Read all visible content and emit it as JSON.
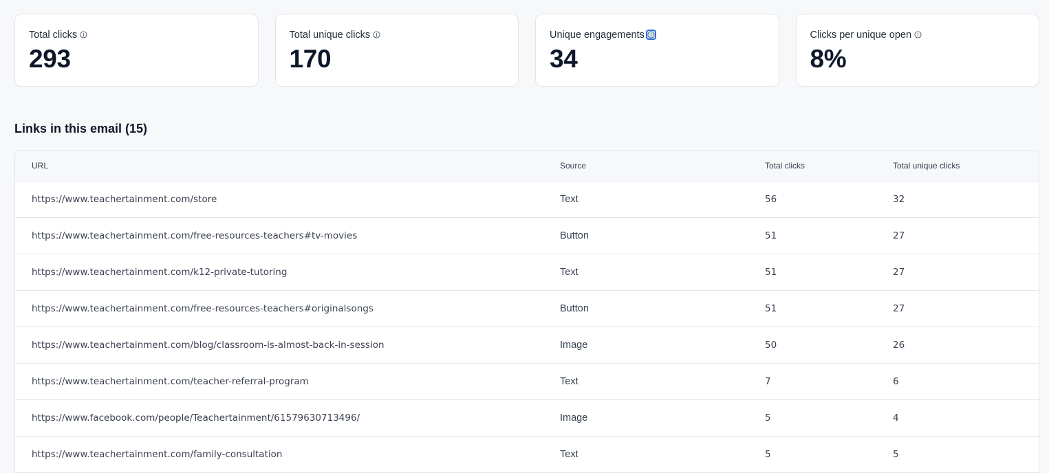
{
  "stats": [
    {
      "label": "Total clicks",
      "value": "293",
      "focused": false
    },
    {
      "label": "Total unique clicks",
      "value": "170",
      "focused": false
    },
    {
      "label": "Unique engagements",
      "value": "34",
      "focused": true
    },
    {
      "label": "Clicks per unique open",
      "value": "8%",
      "focused": false
    }
  ],
  "links_section": {
    "title": "Links in this email (15)"
  },
  "table": {
    "headers": {
      "url": "URL",
      "source": "Source",
      "total_clicks": "Total clicks",
      "total_unique_clicks": "Total unique clicks"
    },
    "rows": [
      {
        "url": "https://www.teachertainment.com/store",
        "source": "Text",
        "total_clicks": "56",
        "total_unique_clicks": "32"
      },
      {
        "url": "https://www.teachertainment.com/free-resources-teachers#tv-movies",
        "source": "Button",
        "total_clicks": "51",
        "total_unique_clicks": "27"
      },
      {
        "url": "https://www.teachertainment.com/k12-private-tutoring",
        "source": "Text",
        "total_clicks": "51",
        "total_unique_clicks": "27"
      },
      {
        "url": "https://www.teachertainment.com/free-resources-teachers#originalsongs",
        "source": "Button",
        "total_clicks": "51",
        "total_unique_clicks": "27"
      },
      {
        "url": "https://www.teachertainment.com/blog/classroom-is-almost-back-in-session",
        "source": "Image",
        "total_clicks": "50",
        "total_unique_clicks": "26"
      },
      {
        "url": "https://www.teachertainment.com/teacher-referral-program",
        "source": "Text",
        "total_clicks": "7",
        "total_unique_clicks": "6"
      },
      {
        "url": "https://www.facebook.com/people/Teachertainment/61579630713496/",
        "source": "Image",
        "total_clicks": "5",
        "total_unique_clicks": "4"
      },
      {
        "url": "https://www.teachertainment.com/family-consultation",
        "source": "Text",
        "total_clicks": "5",
        "total_unique_clicks": "5"
      }
    ]
  },
  "colors": {
    "background": "#f7f8fa",
    "card": "#ffffff",
    "border": "#e3e5ea",
    "focus_ring": "#2f6fdb"
  },
  "icons": {
    "info": "info-circle-icon"
  }
}
